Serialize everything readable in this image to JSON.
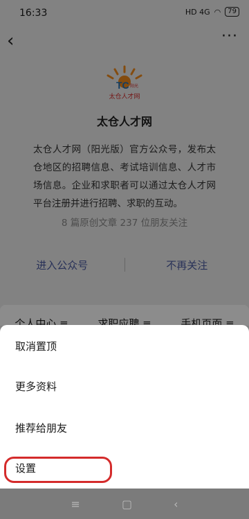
{
  "status": {
    "time": "16:33",
    "network": "HD 4G",
    "battery": "79"
  },
  "nav": {
    "back_icon": "chevron-left-icon",
    "more_icon": "more-dots-icon"
  },
  "profile": {
    "name": "太仓人才网",
    "logo_text": "太仓人才网",
    "logo_badge": "阳光",
    "description": "太仓人才网（阳光版）官方公众号，发布太仓地区的招聘信息、考试培训信息、人才市场信息。企业和求职者可以通过太仓人才网平台注册并进行招聘、求职的互动。",
    "stats": "8 篇原创文章  237 位朋友关注",
    "enter_label": "进入公众号",
    "unfollow_label": "不再关注"
  },
  "menus": [
    "个人中心 ≡",
    "求职应聘 ≡",
    "手机页面 ≡"
  ],
  "sheet": {
    "items": [
      "取消置顶",
      "更多资料",
      "推荐给朋友",
      "设置"
    ]
  },
  "colors": {
    "accent_link": "#4a5aa0",
    "highlight": "#d42b2b"
  }
}
